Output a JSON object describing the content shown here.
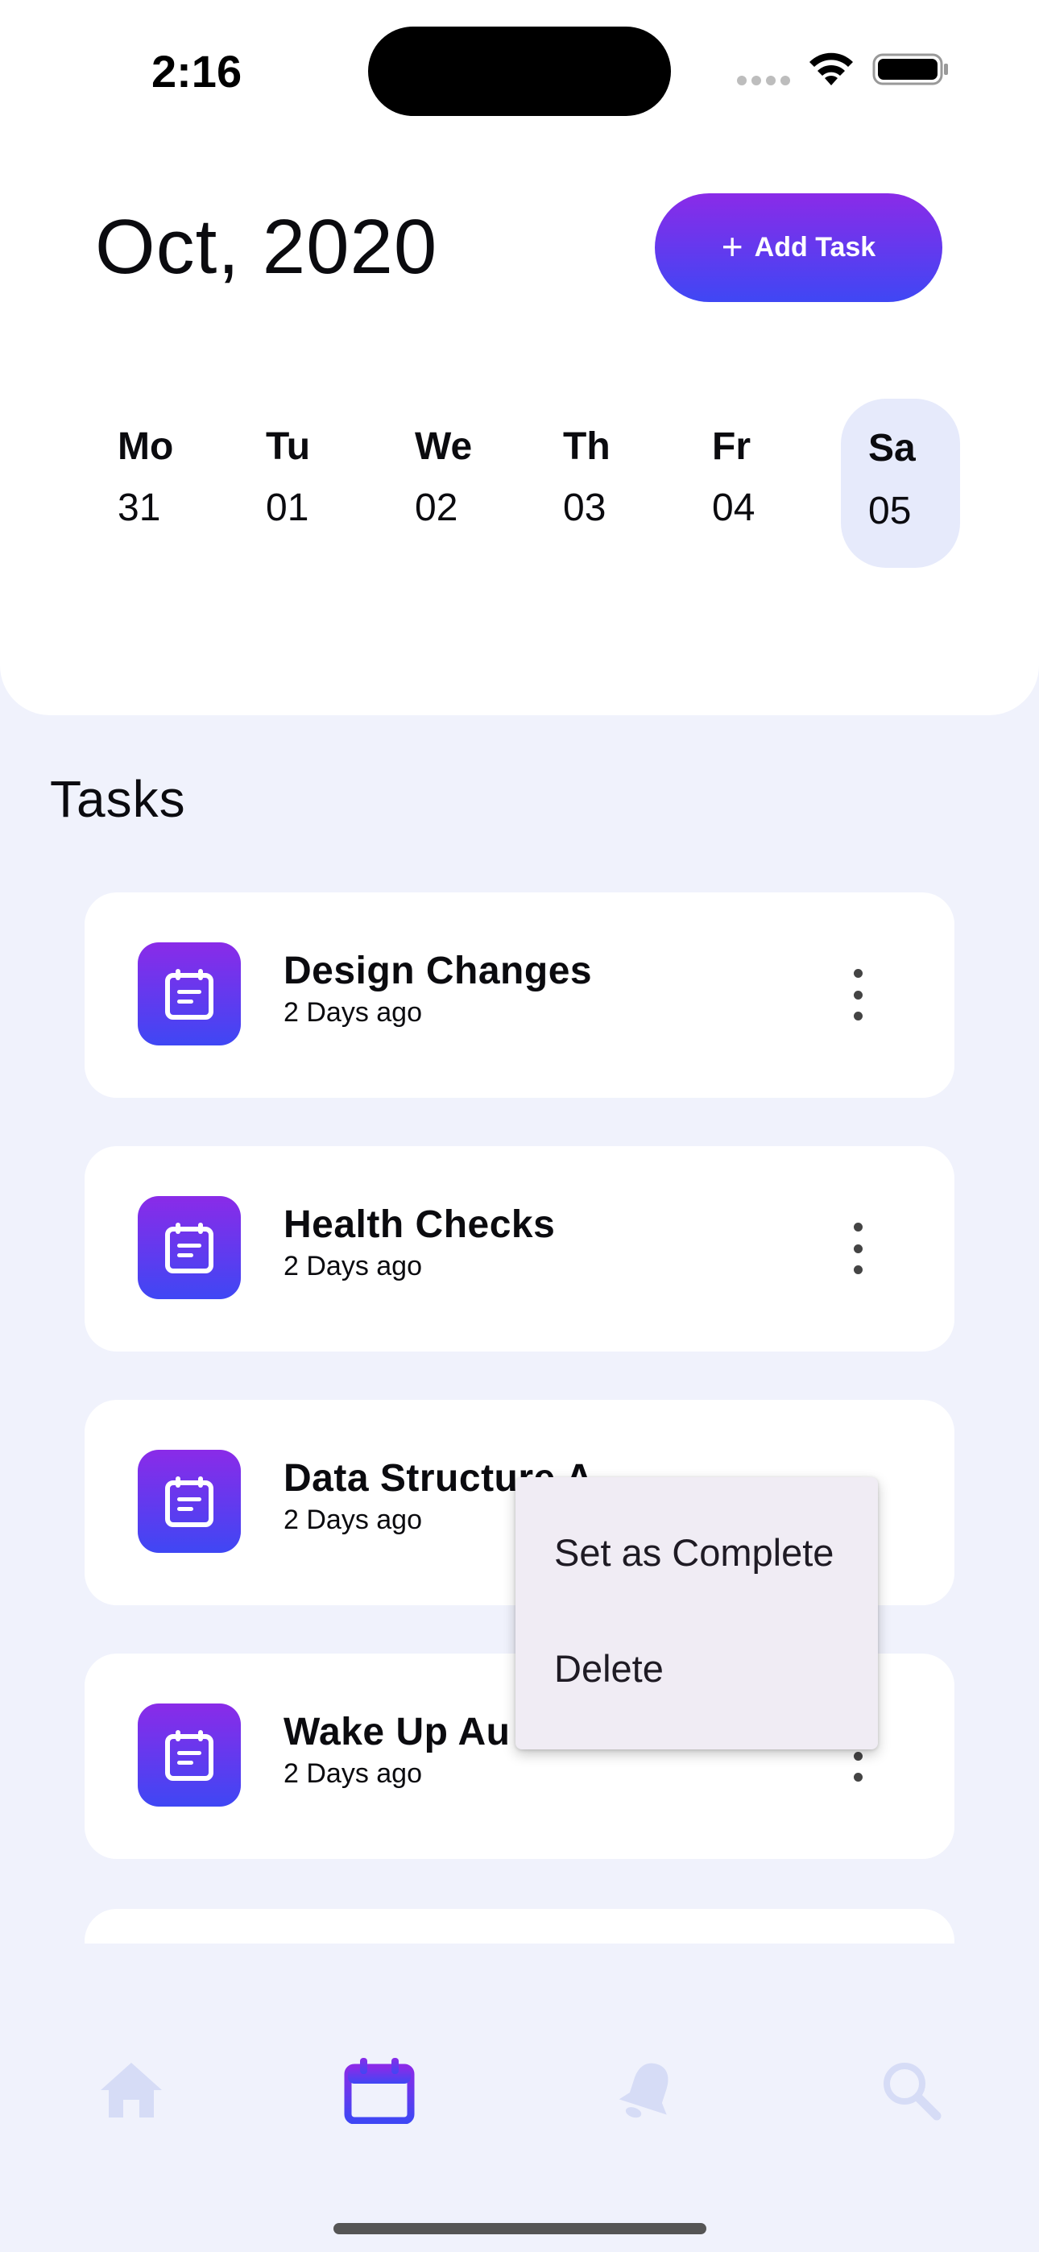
{
  "status_bar": {
    "time": "2:16"
  },
  "header": {
    "month_title": "Oct, 2020",
    "add_task_label": "Add Task"
  },
  "dates": [
    {
      "day": "Mo",
      "num": "31"
    },
    {
      "day": "Tu",
      "num": "01"
    },
    {
      "day": "We",
      "num": "02"
    },
    {
      "day": "Th",
      "num": "03"
    },
    {
      "day": "Fr",
      "num": "04"
    },
    {
      "day": "Sa",
      "num": "05",
      "selected": true
    }
  ],
  "tasks_title": "Tasks",
  "tasks": [
    {
      "title": "Design Changes",
      "subtitle": "2 Days ago"
    },
    {
      "title": "Health Checks",
      "subtitle": "2 Days ago"
    },
    {
      "title": "Data Structure A",
      "subtitle": "2 Days ago"
    },
    {
      "title": "Wake Up Au",
      "subtitle": "2 Days ago"
    }
  ],
  "context_menu": {
    "set_complete": "Set as Complete",
    "delete": "Delete"
  },
  "bottom_nav": {
    "items": [
      {
        "icon": "home-icon",
        "active": false
      },
      {
        "icon": "calendar-icon",
        "active": true
      },
      {
        "icon": "bell-icon",
        "active": false
      },
      {
        "icon": "search-icon",
        "active": false
      }
    ]
  },
  "colors": {
    "accent_start": "#8A2BE8",
    "accent_end": "#3F47F4",
    "background": "#F0F2FC",
    "selected_date": "#E6EAFB",
    "inactive_nav": "#D6DCF6"
  }
}
